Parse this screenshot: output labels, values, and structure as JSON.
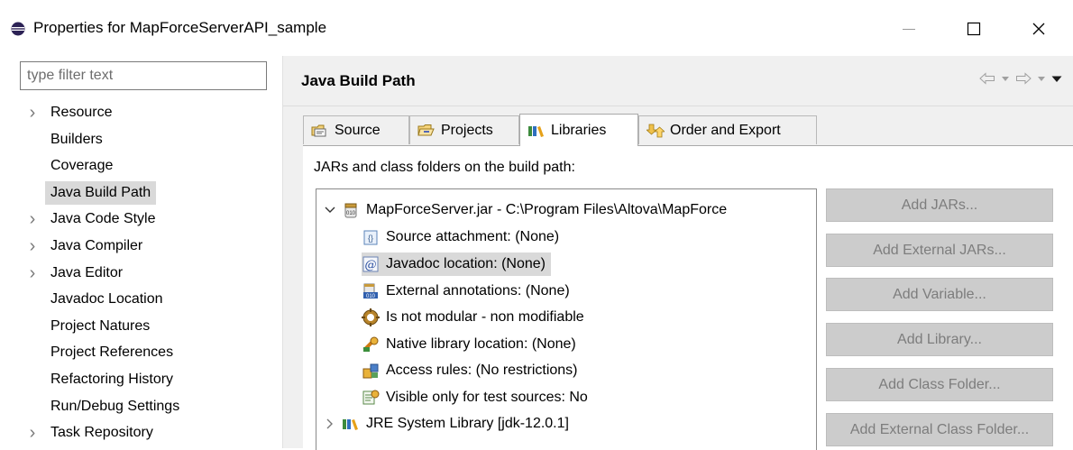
{
  "window": {
    "title": "Properties for MapForceServerAPI_sample",
    "icon": "eclipse-icon",
    "minimize_glyph": "—",
    "maximize_glyph": "☐",
    "close_glyph": "✕"
  },
  "filter": {
    "placeholder": "type filter text",
    "value": ""
  },
  "nav": {
    "items": [
      {
        "label": "Resource",
        "expandable": true
      },
      {
        "label": "Builders",
        "expandable": false
      },
      {
        "label": "Coverage",
        "expandable": false
      },
      {
        "label": "Java Build Path",
        "expandable": false,
        "selected": true
      },
      {
        "label": "Java Code Style",
        "expandable": true
      },
      {
        "label": "Java Compiler",
        "expandable": true
      },
      {
        "label": "Java Editor",
        "expandable": true
      },
      {
        "label": "Javadoc Location",
        "expandable": false
      },
      {
        "label": "Project Natures",
        "expandable": false
      },
      {
        "label": "Project References",
        "expandable": false
      },
      {
        "label": "Refactoring History",
        "expandable": false
      },
      {
        "label": "Run/Debug Settings",
        "expandable": false
      },
      {
        "label": "Task Repository",
        "expandable": true
      }
    ]
  },
  "page": {
    "title": "Java Build Path",
    "tabs": [
      {
        "label": "Source",
        "icon": "source-folder-icon"
      },
      {
        "label": "Projects",
        "icon": "projects-folder-icon"
      },
      {
        "label": "Libraries",
        "icon": "libraries-icon",
        "active": true
      },
      {
        "label": "Order and Export",
        "icon": "order-export-icon"
      }
    ],
    "list_label": "JARs and class folders on the build path:",
    "tree": [
      {
        "label": "MapForceServer.jar - C:\\Program Files\\Altova\\MapForce",
        "icon": "jar-icon",
        "expanded": true
      },
      {
        "label": "Source attachment: (None)",
        "icon": "source-attachment-icon"
      },
      {
        "label": "Javadoc location: (None)",
        "icon": "javadoc-icon",
        "selected": true
      },
      {
        "label": "External annotations: (None)",
        "icon": "annotations-icon"
      },
      {
        "label": "Is not modular - non modifiable",
        "icon": "module-icon"
      },
      {
        "label": "Native library location: (None)",
        "icon": "native-library-icon"
      },
      {
        "label": "Access rules: (No restrictions)",
        "icon": "access-rules-icon"
      },
      {
        "label": "Visible only for test sources: No",
        "icon": "test-sources-icon"
      },
      {
        "label": "JRE System Library [jdk-12.0.1]",
        "icon": "jre-library-icon",
        "expanded": false
      }
    ],
    "buttons": [
      {
        "label": "Add JARs...",
        "enabled": false
      },
      {
        "label": "Add External JARs...",
        "enabled": false
      },
      {
        "label": "Add Variable...",
        "enabled": false
      },
      {
        "label": "Add Library...",
        "enabled": false
      },
      {
        "label": "Add Class Folder...",
        "enabled": false
      },
      {
        "label": "Add External Class Folder...",
        "enabled": false
      }
    ]
  },
  "colors": {
    "selection": "#d9d9d9",
    "panel": "#f0f0f0",
    "disabled_button": "#cccccc",
    "disabled_text": "#7d7d7d"
  }
}
